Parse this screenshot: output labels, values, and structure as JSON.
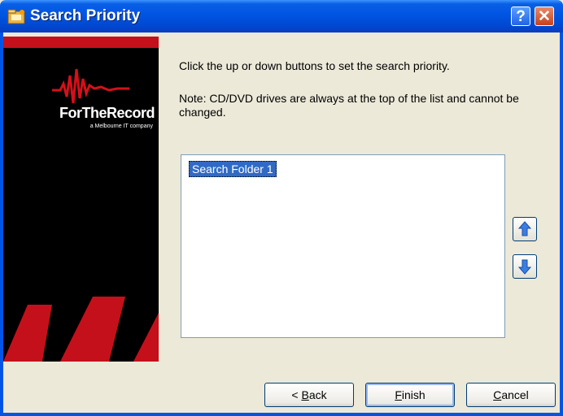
{
  "window": {
    "title": "Search Priority",
    "help_label": "?",
    "close_label": "✕"
  },
  "branding": {
    "name": "ForTheRecord",
    "tagline": "a Melbourne IT company"
  },
  "content": {
    "instruction": "Click the up or down buttons to set the search priority.",
    "note": "Note: CD/DVD drives are always at the top of the list and cannot be changed."
  },
  "list": {
    "items": [
      "Search Folder 1"
    ]
  },
  "buttons": {
    "back": {
      "pre": "< ",
      "accel": "B",
      "rest": "ack"
    },
    "finish": {
      "accel": "F",
      "rest": "inish"
    },
    "cancel": {
      "accel": "C",
      "rest": "ancel"
    }
  },
  "icons": {
    "up": "arrow-up-icon",
    "down": "arrow-down-icon"
  },
  "colors": {
    "title_blue": "#0054e3",
    "brand_red": "#c4101a",
    "selection": "#316ac5"
  }
}
